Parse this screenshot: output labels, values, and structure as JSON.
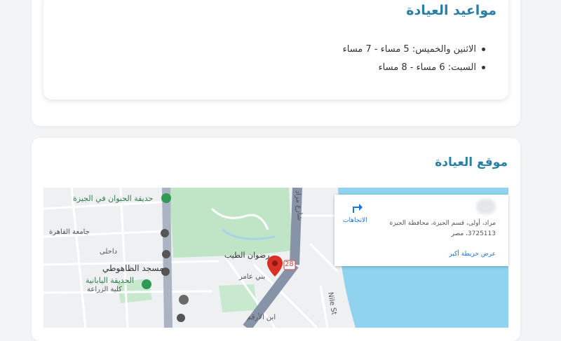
{
  "hours": {
    "title": "مواعيد العيادة",
    "items": [
      "الاثنين والخميس: 5 مساء - 7 مساء",
      "السبت: 6 مساء - 8 مساء"
    ]
  },
  "location": {
    "title": "موقع العيادة"
  },
  "map": {
    "labels": {
      "zoo": "حديقة الحيوان في الجيزة",
      "mosque": "مسجد الظاهوطي",
      "garden": "الحديقة اليابانية",
      "agri": "كلية الزراعة",
      "cairo_univ": "جامعة القاهرة",
      "radwan": "رضوان الطيب",
      "murad": "شارع مراد",
      "route": "28",
      "nile_st": "Nile St",
      "ibn_alarqam": "ابن الأرقم",
      "bani_amer": "بني عامر",
      "dohi": "داحلى"
    },
    "info": {
      "address": "مراد، أولى، قسم الجيزة، محافظة الجيزة 3725113، مصر",
      "more_link": "عرض خريطة أكبر",
      "directions": "الاتجاهات"
    }
  }
}
